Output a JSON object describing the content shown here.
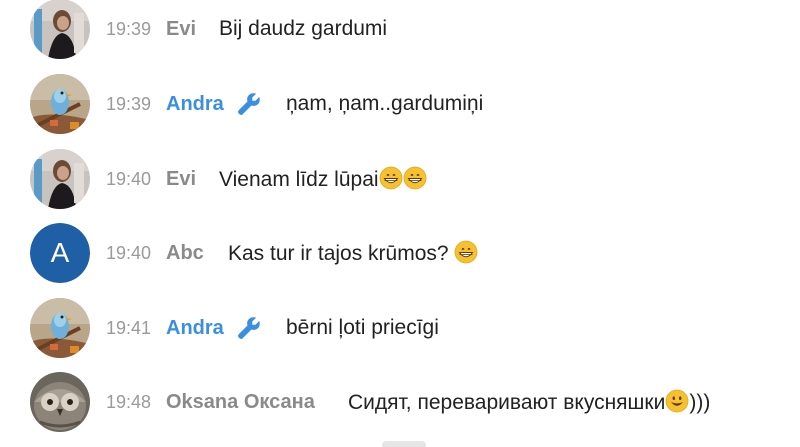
{
  "messages": [
    {
      "time": "19:39",
      "author": "Evi",
      "text": "Bij daudz gardumi",
      "avatar": "photo-evi",
      "moderator": false
    },
    {
      "time": "19:39",
      "author": "Andra",
      "text": "ņam, ņam..gardumiņi",
      "avatar": "photo-andra-bird",
      "moderator": true
    },
    {
      "time": "19:40",
      "author": "Evi",
      "text": "Vienam līdz lūpai",
      "avatar": "photo-evi",
      "moderator": false,
      "emoji": [
        "grinning-face",
        "grinning-face"
      ]
    },
    {
      "time": "19:40",
      "author": "Abc",
      "text": "Kas tur ir tajos krūmos?",
      "avatar_letter": "A",
      "moderator": false,
      "emoji": [
        "grinning-face"
      ]
    },
    {
      "time": "19:41",
      "author": "Andra",
      "text": "bērni ļoti priecīgi",
      "avatar": "photo-andra-bird",
      "moderator": true
    },
    {
      "time": "19:48",
      "author": "Oksana Оксана",
      "text": "Сидят, переваривают вкусняшки",
      "text_after": ")))",
      "avatar": "photo-owl",
      "moderator": false,
      "emoji": [
        "smiling-face"
      ]
    }
  ],
  "colors": {
    "moderator_name": "#3a8fe0",
    "regular_name": "#8a8a8a",
    "time": "#9a9a9a",
    "letter_avatar_bg": "#1e5fa6",
    "wrench_icon": "#3a8fe0"
  },
  "icons": {
    "moderator_badge": "wrench-icon",
    "emoji": "grinning-face-emoji"
  }
}
